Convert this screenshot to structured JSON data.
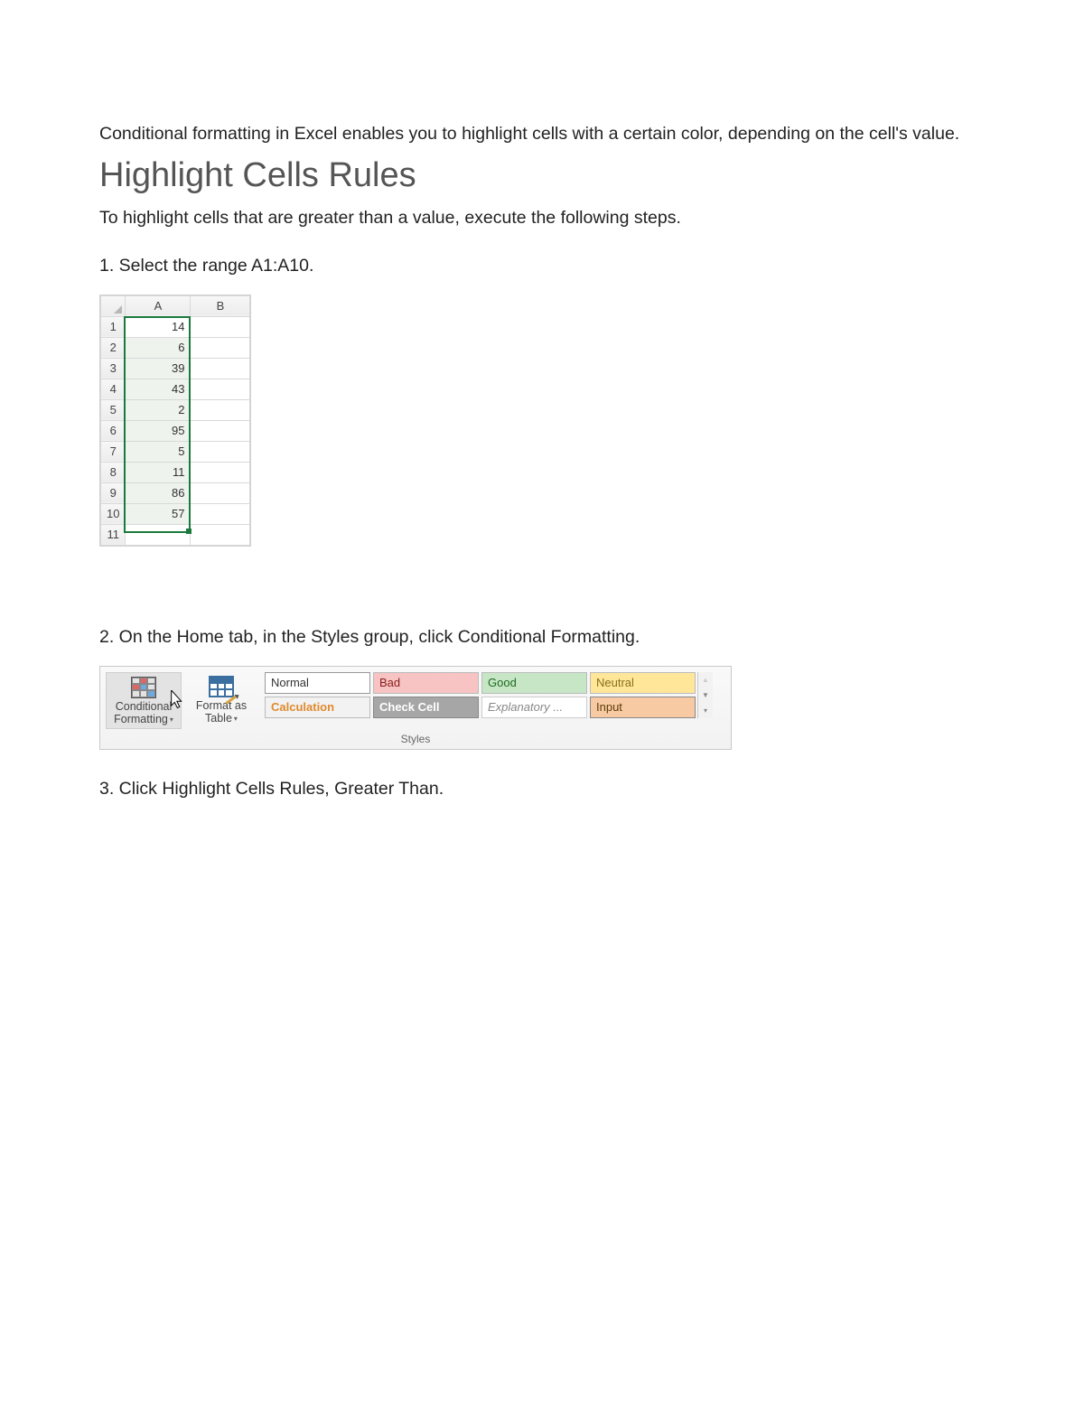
{
  "intro": "Conditional formatting in Excel enables you to highlight cells with a certain color, depending on the cell's value.",
  "heading": "Highlight Cells Rules",
  "subintro": "To highlight cells that are greater than a value, execute the following steps.",
  "steps": {
    "s1": "1. Select the range A1:A10.",
    "s2": "2. On the Home tab, in the Styles group, click Conditional Formatting.",
    "s3": "3. Click Highlight Cells Rules, Greater Than."
  },
  "sheet": {
    "columns": [
      "A",
      "B"
    ],
    "row_labels": [
      "1",
      "2",
      "3",
      "4",
      "5",
      "6",
      "7",
      "8",
      "9",
      "10",
      "11"
    ],
    "colA_values": [
      "14",
      "6",
      "39",
      "43",
      "2",
      "95",
      "5",
      "11",
      "86",
      "57",
      ""
    ],
    "selected_range": "A1:A10"
  },
  "ribbon": {
    "group_label": "Styles",
    "buttons": {
      "conditional_formatting": {
        "line1": "Conditional",
        "line2": "Formatting"
      },
      "format_as_table": {
        "line1": "Format as",
        "line2": "Table"
      }
    },
    "cell_styles": {
      "normal": "Normal",
      "bad": "Bad",
      "good": "Good",
      "neutral": "Neutral",
      "calculation": "Calculation",
      "check_cell": "Check Cell",
      "explanatory": "Explanatory ...",
      "input": "Input"
    }
  }
}
